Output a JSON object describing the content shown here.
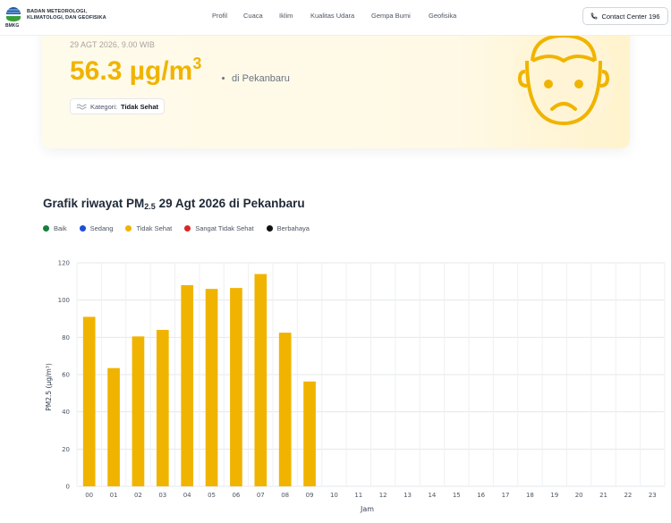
{
  "header": {
    "org_lines": [
      "BADAN METEOROLOGI,",
      "KLIMATOLOGI, DAN GEOFISIKA"
    ],
    "logo_caption": "BMKG",
    "nav": [
      "Profil",
      "Cuaca",
      "Iklim",
      "Kualitas Udara",
      "Gempa Bumi",
      "Geofisika"
    ],
    "contact_label": "Contact Center 196"
  },
  "card": {
    "date": "29 AGT 2026, 9.00 WIB",
    "value": "56.3 µg/m",
    "value_exp": "3",
    "location": "di Pekanbaru",
    "category_label": "Kategori:",
    "category_value": "Tidak Sehat",
    "accent": "#f0b400"
  },
  "chart_section": {
    "title_pre": "Grafik riwayat PM",
    "title_sub": "2.5",
    "title_post": " 29 Agt 2026 di Pekanbaru",
    "legend": [
      {
        "label": "Baik",
        "color": "#15803d"
      },
      {
        "label": "Sedang",
        "color": "#1d4ed8"
      },
      {
        "label": "Tidak Sehat",
        "color": "#f0b400"
      },
      {
        "label": "Sangat Tidak Sehat",
        "color": "#dc2626"
      },
      {
        "label": "Berbahaya",
        "color": "#111111"
      }
    ]
  },
  "chart_data": {
    "type": "bar",
    "categories": [
      "00",
      "01",
      "02",
      "03",
      "04",
      "05",
      "06",
      "07",
      "08",
      "09",
      "10",
      "11",
      "12",
      "13",
      "14",
      "15",
      "16",
      "17",
      "18",
      "19",
      "20",
      "21",
      "22",
      "23"
    ],
    "values": [
      91,
      63.5,
      80.5,
      84,
      108,
      106,
      106.5,
      114,
      82.5,
      56.3,
      null,
      null,
      null,
      null,
      null,
      null,
      null,
      null,
      null,
      null,
      null,
      null,
      null,
      null
    ],
    "xlabel": "Jam",
    "ylabel": "PM2.5 (µg/m³)",
    "ylim": [
      0,
      120
    ],
    "yticks": [
      0,
      20,
      40,
      60,
      80,
      100,
      120
    ],
    "bar_color": "#f0b400",
    "grid": true
  }
}
